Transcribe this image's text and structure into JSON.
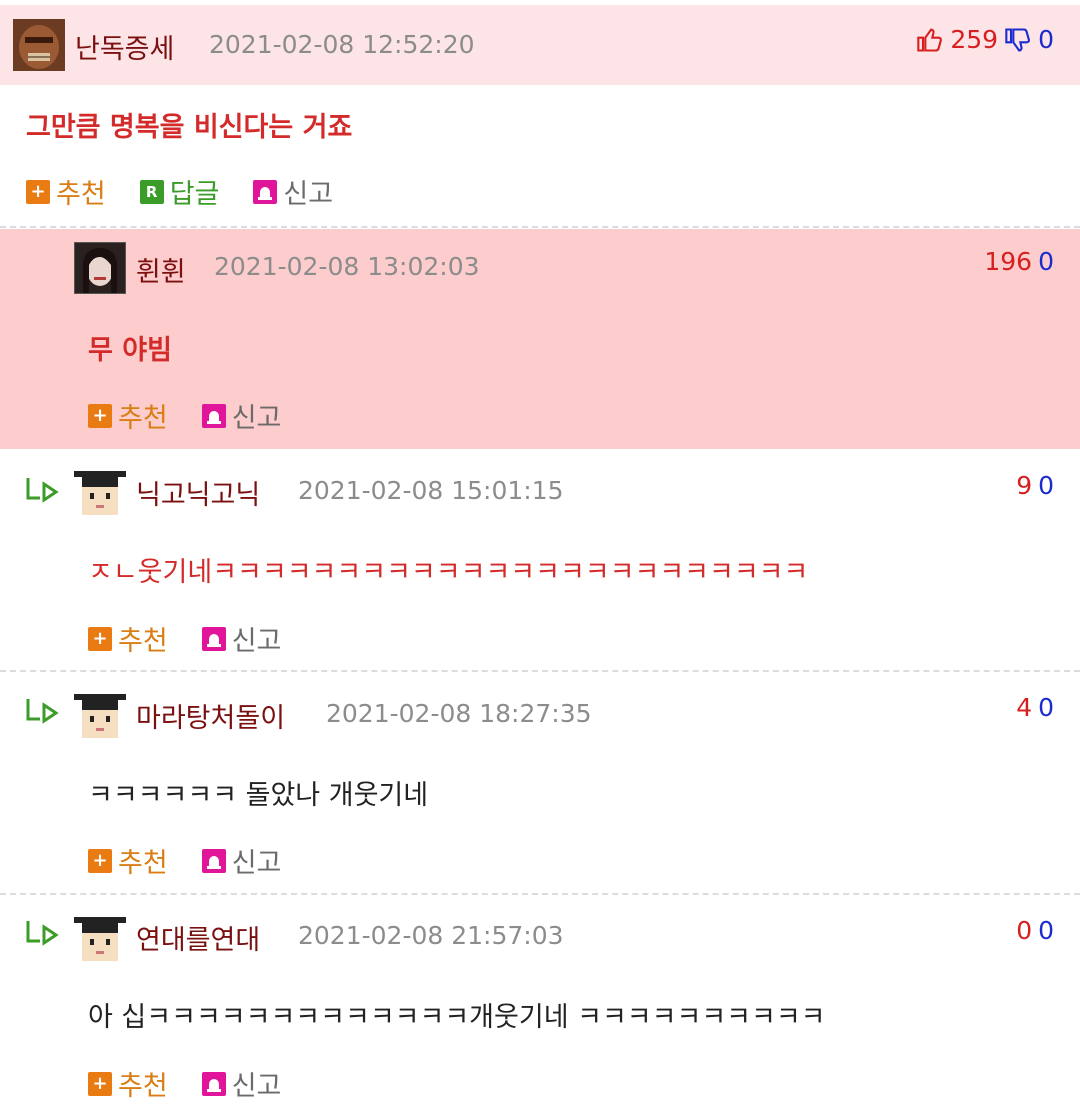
{
  "comments": [
    {
      "username": "난독증세",
      "datetime": "2021-02-08 12:52:20",
      "upvotes": "259",
      "downvotes": "0",
      "text": "그만큼 명복을 비신다는 거죠",
      "actions": {
        "recommend": "추천",
        "reply": "답글",
        "report": "신고"
      }
    },
    {
      "username": "휜휜",
      "datetime": "2021-02-08 13:02:03",
      "upvotes": "196",
      "downvotes": "0",
      "text": "무 야빔",
      "actions": {
        "recommend": "추천",
        "report": "신고"
      }
    },
    {
      "username": "닉고닉고닉",
      "datetime": "2021-02-08 15:01:15",
      "upvotes": "9",
      "downvotes": "0",
      "text": "ㅈㄴ웃기네ㅋㅋㅋㅋㅋㅋㅋㅋㅋㅋㅋㅋㅋㅋㅋㅋㅋㅋㅋㅋㅋㅋㅋㅋ",
      "actions": {
        "recommend": "추천",
        "report": "신고"
      }
    },
    {
      "username": "마라탕처돌이",
      "datetime": "2021-02-08 18:27:35",
      "upvotes": "4",
      "downvotes": "0",
      "text": "ㅋㅋㅋㅋㅋㅋ 돌았나 개웃기네",
      "actions": {
        "recommend": "추천",
        "report": "신고"
      }
    },
    {
      "username": "연대를연대",
      "datetime": "2021-02-08 21:57:03",
      "upvotes": "0",
      "downvotes": "0",
      "text": "아 십ㅋㅋㅋㅋㅋㅋㅋㅋㅋㅋㅋㅋㅋ개웃기네 ㅋㅋㅋㅋㅋㅋㅋㅋㅋㅋ",
      "actions": {
        "recommend": "추천",
        "report": "신고"
      }
    }
  ],
  "icons": {
    "thumbs_up": "thumbs-up-icon",
    "thumbs_down": "thumbs-down-icon",
    "recommend": "plus-icon",
    "reply": "reply-r-icon",
    "report": "siren-icon",
    "nested_reply": "reply-arrow-icon"
  },
  "colors": {
    "header_bg": "#fde4e6",
    "highlight_bg": "#fdcccc",
    "username": "#7a1010",
    "upvote": "#d81f1f",
    "downvote": "#1a2bd0",
    "recommend": "#ea7a12",
    "reply": "#3c9c2a",
    "report": "#e0159a"
  }
}
